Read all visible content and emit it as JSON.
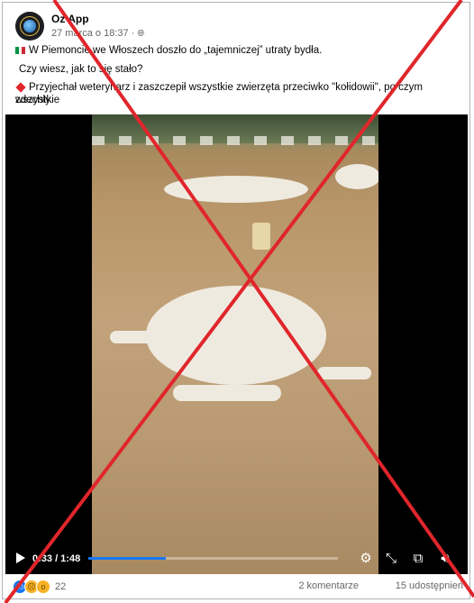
{
  "post": {
    "page_name": "Oz App",
    "date": "27 marca o 18:37 ·",
    "line1": "W Piemoncie we Włoszech doszło do „tajemniczej” utraty bydła.",
    "line2": "Czy wiesz, jak to się stało?",
    "line3a": "Przyjechał weterynarz i zaszczepił wszystkie zwierzęta przeciwko \"kołidowii\", po czym wszystkie",
    "line3b": "zdechły."
  },
  "video": {
    "time": "0:33 / 1:48",
    "progress": 0.31
  },
  "footer": {
    "reaction_count": "22",
    "comments": "2 komentarze",
    "shares": "15 udostępnień"
  },
  "colors": {
    "accent": "#1877f2",
    "cross": "#e0262b",
    "flag_green": "#009246",
    "flag_red": "#ce2b37"
  },
  "icons": [
    "globe-icon",
    "play-icon",
    "settings-icon",
    "fullscreen-exit-icon",
    "picture-in-picture-icon",
    "volume-icon",
    "like-icon",
    "sad-icon",
    "wow-icon"
  ]
}
